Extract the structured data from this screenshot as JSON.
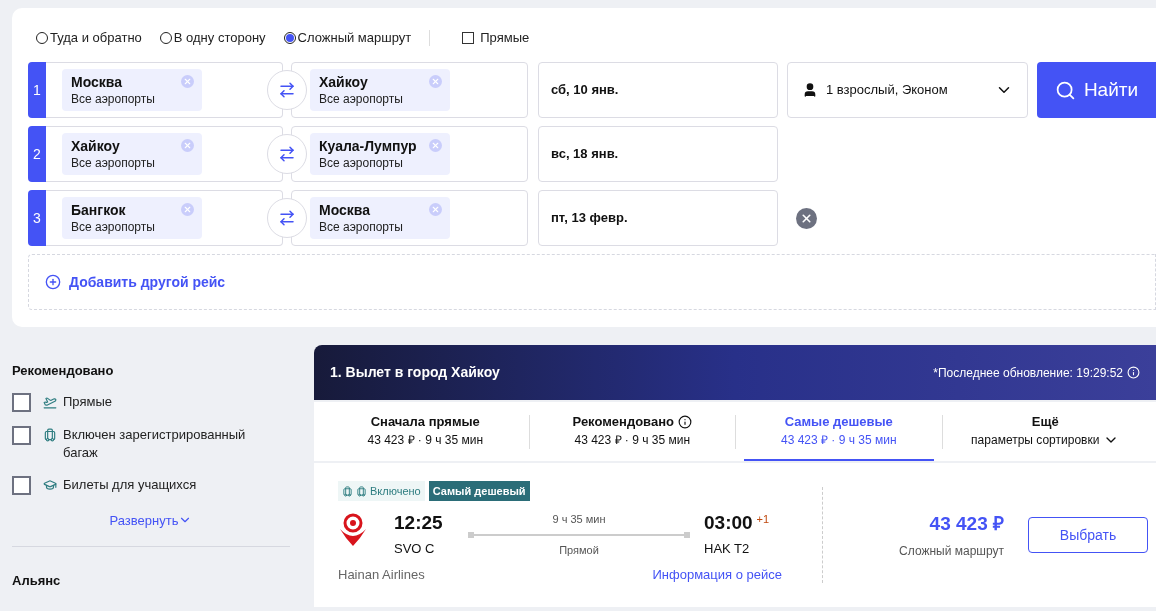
{
  "trip_types": [
    {
      "label": "Туда и обратно",
      "selected": false
    },
    {
      "label": "В одну сторону",
      "selected": false
    },
    {
      "label": "Сложный маршрут",
      "selected": true
    }
  ],
  "direct_only": {
    "label": "Прямые",
    "checked": false
  },
  "legs": [
    {
      "number": "1",
      "from": {
        "city": "Москва",
        "airports": "Все аэропорты"
      },
      "to": {
        "city": "Хайкоу",
        "airports": "Все аэропорты"
      },
      "date": "сб, 10 янв.",
      "removable": false
    },
    {
      "number": "2",
      "from": {
        "city": "Хайкоу",
        "airports": "Все аэропорты"
      },
      "to": {
        "city": "Куала-Лумпур",
        "airports": "Все аэропорты"
      },
      "date": "вс, 18 янв.",
      "removable": false
    },
    {
      "number": "3",
      "from": {
        "city": "Бангкок",
        "airports": "Все аэропорты"
      },
      "to": {
        "city": "Москва",
        "airports": "Все аэропорты"
      },
      "date": "пт, 13 февр.",
      "removable": true
    }
  ],
  "passengers": "1 взрослый, Эконом",
  "search_button": "Найти",
  "add_leg": "Добавить другой рейс",
  "filters": {
    "title": "Рекомендовано",
    "items": [
      {
        "kind": "direct",
        "label": "Прямые",
        "checked": false
      },
      {
        "kind": "baggage",
        "label": "Включен зарегистрированный багаж",
        "checked": false
      },
      {
        "kind": "student",
        "label": "Билеты для учащихся",
        "checked": false
      }
    ],
    "expand": "Развернуть",
    "next_section": "Альянс"
  },
  "results": {
    "title": "1. Вылет в город Хайкоу",
    "updated": "*Последнее обновление: 19:29:52",
    "sort_tabs": [
      {
        "kind": "plain",
        "title": "Сначала прямые",
        "subtitle": "43 423 ₽ · 9 ч 35 мин",
        "selected": false
      },
      {
        "kind": "info",
        "title": "Рекомендовано",
        "subtitle": "43 423 ₽ · 9 ч 35 мин",
        "selected": false
      },
      {
        "kind": "plain",
        "title": "Самые дешевые",
        "subtitle": "43 423 ₽ · 9 ч 35 мин",
        "selected": true
      },
      {
        "kind": "menu",
        "title": "Ещё",
        "subtitle": "параметры сортировки",
        "selected": false
      }
    ],
    "offer": {
      "baggage": "Включено",
      "tag": "Самый дешевый",
      "dep_time": "12:25",
      "dep_airport": "SVO C",
      "duration": "9 ч 35 мин",
      "stops": "Прямой",
      "arr_time": "03:00",
      "day_offset": "+1",
      "arr_airport": "HAK T2",
      "airline": "Hainan Airlines",
      "details_link": "Информация о рейсе",
      "price": "43 423 ₽",
      "price_note": "Сложный маршрут",
      "select_button": "Выбрать"
    }
  }
}
